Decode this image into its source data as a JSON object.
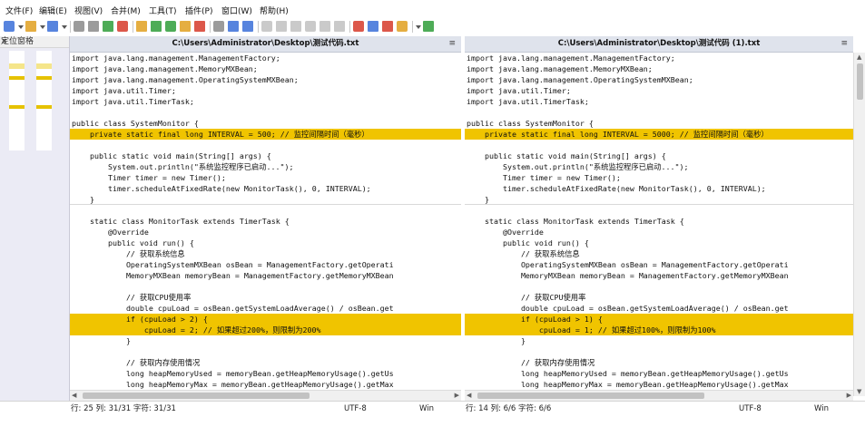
{
  "menu": [
    "文件(F)",
    "编辑(E)",
    "视图(V)",
    "合并(M)",
    "工具(T)",
    "插件(P)",
    "窗口(W)",
    "帮助(H)"
  ],
  "toolbar": {
    "icons": [
      "new-file-icon",
      "dropdown-arrow-icon",
      "open-folder-icon",
      "dropdown-arrow-icon",
      "save-icon",
      "dropdown-arrow-icon",
      "undo-icon",
      "redo-icon",
      "refresh-icon",
      "compare-icon",
      "options-icon",
      "merge-icon",
      "merge-all-icon",
      "highlight-icon",
      "filter-icon",
      "view-icon",
      "previous-diff-icon",
      "next-diff-icon",
      "first-diff-icon",
      "last-diff-icon",
      "copy-left-icon",
      "copy-right-icon",
      "copy-all-left-icon",
      "copy-all-right-icon",
      "next-file-icon",
      "toggle-panel-icon",
      "bookmark-icon",
      "settings-icon",
      "dropdown-arrow-icon",
      "plugin-icon"
    ],
    "colors": {
      "accent": "#e0a020",
      "blue": "#3a6fd8",
      "green": "#2f9e3a",
      "red": "#d63a2a",
      "gray": "#8a8a8a"
    }
  },
  "location_pane": {
    "title": "定位窗格",
    "close": "×"
  },
  "left": {
    "title": "C:\\Users\\Administrator\\Desktop\\测试代码.txt",
    "marker": "≡",
    "lines": [
      "import java.lang.management.ManagementFactory;",
      "import java.lang.management.MemoryMXBean;",
      "import java.lang.management.OperatingSystemMXBean;",
      "import java.util.Timer;",
      "import java.util.TimerTask;",
      "",
      "public class SystemMonitor {",
      "    private static final long INTERVAL = 500; // 监控间隔时间（毫秒）",
      "",
      "    public static void main(String[] args) {",
      "        System.out.println(\"系统监控程序已启动...\");",
      "        Timer timer = new Timer();",
      "        timer.scheduleAtFixedRate(new MonitorTask(), 0, INTERVAL);",
      "    }",
      "",
      "    static class MonitorTask extends TimerTask {",
      "        @Override",
      "        public void run() {",
      "            // 获取系统信息",
      "            OperatingSystemMXBean osBean = ManagementFactory.getOperati",
      "            MemoryMXBean memoryBean = ManagementFactory.getMemoryMXBean",
      "",
      "            // 获取CPU使用率",
      "            double cpuLoad = osBean.getSystemLoadAverage() / osBean.get",
      "            if (cpuLoad > 2) {",
      "                cpuLoad = 2; // 如果超过200%，则限制为200%",
      "            }",
      "",
      "            // 获取内存使用情况",
      "            long heapMemoryUsed = memoryBean.getHeapMemoryUsage().getUs",
      "            long heapMemoryMax = memoryBean.getHeapMemoryUsage().getMax"
    ]
  },
  "right": {
    "title": "C:\\Users\\Administrator\\Desktop\\测试代码 (1).txt",
    "marker": "≡",
    "lines": [
      "import java.lang.management.ManagementFactory;",
      "import java.lang.management.MemoryMXBean;",
      "import java.lang.management.OperatingSystemMXBean;",
      "import java.util.Timer;",
      "import java.util.TimerTask;",
      "",
      "public class SystemMonitor {",
      "    private static final long INTERVAL = 5000; // 监控间隔时间（毫秒）",
      "",
      "    public static void main(String[] args) {",
      "        System.out.println(\"系统监控程序已启动...\");",
      "        Timer timer = new Timer();",
      "        timer.scheduleAtFixedRate(new MonitorTask(), 0, INTERVAL);",
      "    }",
      "",
      "    static class MonitorTask extends TimerTask {",
      "        @Override",
      "        public void run() {",
      "            // 获取系统信息",
      "            OperatingSystemMXBean osBean = ManagementFactory.getOperati",
      "            MemoryMXBean memoryBean = ManagementFactory.getMemoryMXBean",
      "",
      "            // 获取CPU使用率",
      "            double cpuLoad = osBean.getSystemLoadAverage() / osBean.get",
      "            if (cpuLoad > 1) {",
      "                cpuLoad = 1; // 如果超过100%，则限制为100%",
      "            }",
      "",
      "            // 获取内存使用情况",
      "            long heapMemoryUsed = memoryBean.getHeapMemoryUsage().getUs",
      "            long heapMemoryMax = memoryBean.getHeapMemoryUsage().getMax"
    ]
  },
  "changed_lines": [
    7,
    24,
    25
  ],
  "separator_lines": [
    13
  ],
  "highlight_color": "#f0c400",
  "status": {
    "left": {
      "pos": "行: 25  列: 31/31  字符: 31/31",
      "encoding": "UTF-8",
      "eol": "Win"
    },
    "right": {
      "pos": "行: 14  列: 6/6  字符: 6/6",
      "encoding": "UTF-8",
      "eol": "Win"
    }
  }
}
